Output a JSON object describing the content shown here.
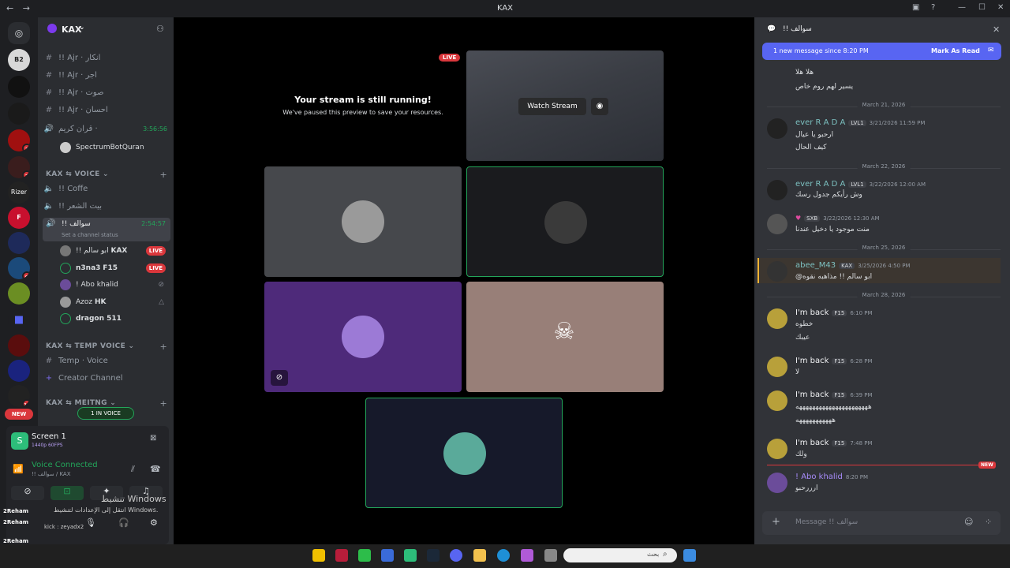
{
  "window": {
    "title": "KAX",
    "back": "←",
    "forward": "→"
  },
  "server": {
    "name": "KAX",
    "guild_badges": [
      "1",
      "2",
      "9",
      "10"
    ],
    "guild_labels": [
      "B2",
      "Rizer",
      "F",
      "9",
      "10"
    ],
    "new_label": "NEW"
  },
  "channels": [
    {
      "name": "!! Ajr · انكار",
      "type": "text"
    },
    {
      "name": "!! Ajr · اجر",
      "type": "text"
    },
    {
      "name": "!! Ajr · صوت",
      "type": "text"
    },
    {
      "name": "!! Ajr · احسان",
      "type": "text"
    },
    {
      "name": "قران كريم ·",
      "type": "voice",
      "timer": "3:56:56"
    }
  ],
  "bot_user": "SpectrumBotQuran",
  "voice_category": "KAX ⇆ VOICE",
  "voice_channels": [
    {
      "name": "!! Coffe"
    },
    {
      "name": "!! بيت الشعر"
    },
    {
      "name": "!! سوالف",
      "timer": "2:54:57",
      "status": "Set a channel status"
    }
  ],
  "voice_users": [
    {
      "name": "!! ابو سالم",
      "tag": "KAX",
      "live": "LIVE"
    },
    {
      "name": "n3na3",
      "tag": "F15",
      "live": "LIVE"
    },
    {
      "name": "! Abo khalid"
    },
    {
      "name": "Azoz",
      "tag": "HK"
    },
    {
      "name": "dragon 511"
    }
  ],
  "temp_category": "KAX ⇆ TEMP VOICE",
  "temp_channels": [
    "Temp · Voice",
    "Creator Channel"
  ],
  "meeting_category": "KAX ⇆ MEITNG",
  "in_voice": "1 IN VOICE",
  "panel": {
    "screen_title": "Screen 1",
    "screen_quality": "1440p 60FPS",
    "voice_connected": "Voice Connected",
    "voice_channel": "!! سوالف / KAX",
    "activate_title": "تنشيط Windows",
    "activate_sub": "انتقل إلى الإعدادات لتنشيط Windows.",
    "user1": "2Reham",
    "user2": "2Reham",
    "user3": "2Reham",
    "kick": "kick : zeyadx2"
  },
  "stage": {
    "live_badge": "LIVE",
    "stream_running": "Your stream is still running!",
    "stream_paused": "We've paused this preview to save your resources.",
    "watch_stream": "Watch Stream"
  },
  "chat": {
    "channel_title": "!! سوالف",
    "new_messages": "1 new message since 8:20 PM",
    "mark_read": "Mark As Read",
    "composer_placeholder": "Message !! سوالف",
    "top_lines": [
      "هلا هلا",
      "يسير لهم روم خاص"
    ],
    "date1": "March 21, 2026",
    "date2": "March 22, 2026",
    "date3": "March 25, 2026",
    "date4": "March 28, 2026",
    "msgs": [
      {
        "user": "ever R A D A",
        "tag": "LVL1",
        "time": "3/21/2026 11:59 PM",
        "lines": [
          "ارحبو يا عيال",
          "كيف الحال"
        ]
      },
      {
        "user": "ever R A D A",
        "tag": "LVL1",
        "time": "3/22/2026 12:00 AM",
        "lines": [
          "وش رأيكم جدول رسك"
        ]
      },
      {
        "user": "",
        "tag": "SXB",
        "time": "3/22/2026 12:30 AM",
        "lines": [
          "منت موجود يا دخيل عندنا"
        ]
      },
      {
        "user": "abee_M43",
        "tag": "KAX",
        "time": "3/25/2026 4:50 PM",
        "lines": [
          "@ابو سالم !! مذاهبه نقوه"
        ]
      },
      {
        "user": "I'm back",
        "tag": "F15",
        "time": "6:10 PM",
        "lines": [
          "خطوه",
          "عيبك"
        ]
      },
      {
        "user": "I'm back",
        "tag": "F15",
        "time": "6:28 PM",
        "lines": [
          "لا"
        ]
      },
      {
        "user": "I'm back",
        "tag": "F15",
        "time": "6:39 PM",
        "lines": [
          "ههههههههههههههههههههههه",
          "هههههههههههه"
        ]
      },
      {
        "user": "I'm back",
        "tag": "F15",
        "time": "7:48 PM",
        "lines": [
          "ولك"
        ]
      },
      {
        "user": "! Abo khalid",
        "tag": "",
        "time": "8:20 PM",
        "lines": [
          "ارررحبو"
        ]
      }
    ],
    "new_tag": "NEW"
  },
  "taskbar": {
    "search_placeholder": "بحث"
  },
  "colors": {
    "accent": "#5865f2",
    "live": "#da373c",
    "green": "#23a55a",
    "chat_bg": "#313338"
  }
}
